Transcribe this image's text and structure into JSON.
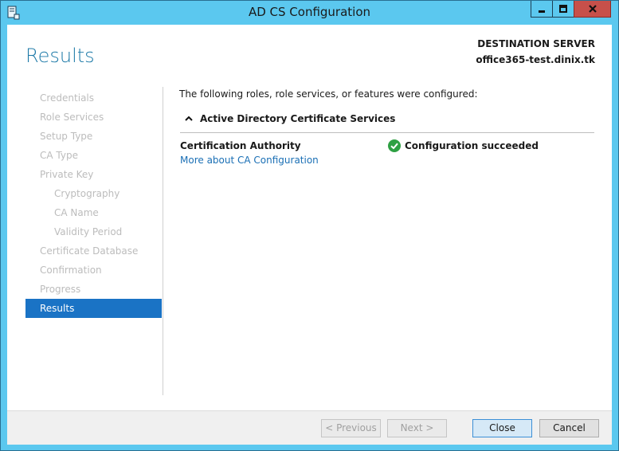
{
  "window": {
    "title": "AD CS Configuration"
  },
  "header": {
    "page_title": "Results",
    "destination_label": "DESTINATION SERVER",
    "destination_value": "office365-test.dinix.tk"
  },
  "nav": {
    "items": [
      {
        "label": "Credentials",
        "level": 0,
        "active": false
      },
      {
        "label": "Role Services",
        "level": 0,
        "active": false
      },
      {
        "label": "Setup Type",
        "level": 0,
        "active": false
      },
      {
        "label": "CA Type",
        "level": 0,
        "active": false
      },
      {
        "label": "Private Key",
        "level": 0,
        "active": false
      },
      {
        "label": "Cryptography",
        "level": 1,
        "active": false
      },
      {
        "label": "CA Name",
        "level": 1,
        "active": false
      },
      {
        "label": "Validity Period",
        "level": 1,
        "active": false
      },
      {
        "label": "Certificate Database",
        "level": 0,
        "active": false
      },
      {
        "label": "Confirmation",
        "level": 0,
        "active": false
      },
      {
        "label": "Progress",
        "level": 0,
        "active": false
      },
      {
        "label": "Results",
        "level": 0,
        "active": true
      }
    ]
  },
  "main": {
    "intro": "The following roles, role services, or features were configured:",
    "section_title": "Active Directory Certificate Services",
    "role_name": "Certification Authority",
    "role_link": "More about CA Configuration",
    "status": "Configuration succeeded"
  },
  "footer": {
    "previous_label": "< Previous",
    "next_label": "Next >",
    "close_label": "Close",
    "cancel_label": "Cancel"
  },
  "colors": {
    "titlebar": "#5bc8ef",
    "accent": "#1e7aa8",
    "nav_active": "#1a73c5",
    "link": "#1a6fb5",
    "success": "#2ea043",
    "close_button": "#c7504a"
  }
}
